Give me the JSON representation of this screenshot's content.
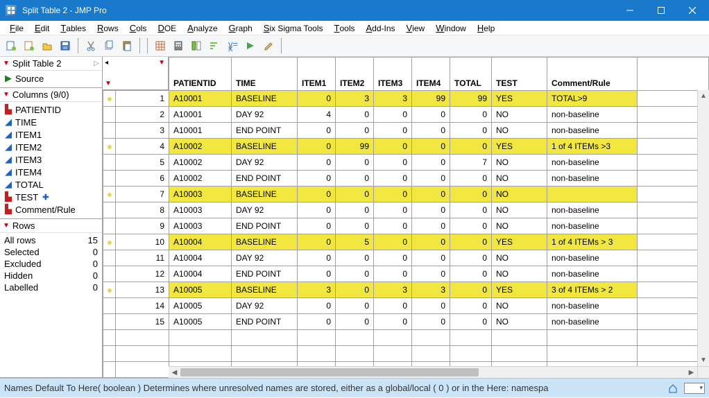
{
  "window": {
    "title": "Split Table 2 - JMP Pro"
  },
  "menu": [
    "File",
    "Edit",
    "Tables",
    "Rows",
    "Cols",
    "DOE",
    "Analyze",
    "Graph",
    "Six Sigma Tools",
    "Tools",
    "Add-Ins",
    "View",
    "Window",
    "Help"
  ],
  "left": {
    "table_name": "Split Table 2",
    "source": "Source",
    "columns_header": "Columns (9/0)",
    "columns": [
      {
        "name": "PATIENTID",
        "type": "red"
      },
      {
        "name": "TIME",
        "type": "blue"
      },
      {
        "name": "ITEM1",
        "type": "blue"
      },
      {
        "name": "ITEM2",
        "type": "blue"
      },
      {
        "name": "ITEM3",
        "type": "blue"
      },
      {
        "name": "ITEM4",
        "type": "blue"
      },
      {
        "name": "TOTAL",
        "type": "blue"
      },
      {
        "name": "TEST",
        "type": "red",
        "plus": true
      },
      {
        "name": "Comment/Rule",
        "type": "red"
      }
    ],
    "rows_header": "Rows",
    "row_stats": [
      {
        "label": "All rows",
        "value": "15"
      },
      {
        "label": "Selected",
        "value": "0"
      },
      {
        "label": "Excluded",
        "value": "0"
      },
      {
        "label": "Hidden",
        "value": "0"
      },
      {
        "label": "Labelled",
        "value": "0"
      }
    ]
  },
  "grid": {
    "headers": [
      "PATIENTID",
      "TIME",
      "ITEM1",
      "ITEM2",
      "ITEM3",
      "ITEM4",
      "TOTAL",
      "TEST",
      "Comment/Rule"
    ],
    "rows": [
      {
        "n": 1,
        "hl": true,
        "dot": true,
        "c": [
          "A10001",
          "BASELINE",
          "0",
          "3",
          "3",
          "99",
          "99",
          "YES",
          "TOTAL>9"
        ]
      },
      {
        "n": 2,
        "hl": false,
        "dot": false,
        "c": [
          "A10001",
          "DAY 92",
          "4",
          "0",
          "0",
          "0",
          "0",
          "NO",
          "non-baseline"
        ]
      },
      {
        "n": 3,
        "hl": false,
        "dot": false,
        "c": [
          "A10001",
          "END POINT",
          "0",
          "0",
          "0",
          "0",
          "0",
          "NO",
          "non-baseline"
        ]
      },
      {
        "n": 4,
        "hl": true,
        "dot": true,
        "c": [
          "A10002",
          "BASELINE",
          "0",
          "99",
          "0",
          "0",
          "0",
          "YES",
          "1 of 4 ITEMs >3"
        ]
      },
      {
        "n": 5,
        "hl": false,
        "dot": false,
        "c": [
          "A10002",
          "DAY 92",
          "0",
          "0",
          "0",
          "0",
          "7",
          "NO",
          "non-baseline"
        ]
      },
      {
        "n": 6,
        "hl": false,
        "dot": false,
        "c": [
          "A10002",
          "END POINT",
          "0",
          "0",
          "0",
          "0",
          "0",
          "NO",
          "non-baseline"
        ]
      },
      {
        "n": 7,
        "hl": true,
        "dot": true,
        "c": [
          "A10003",
          "BASELINE",
          "0",
          "0",
          "0",
          "0",
          "0",
          "NO",
          ""
        ]
      },
      {
        "n": 8,
        "hl": false,
        "dot": false,
        "c": [
          "A10003",
          "DAY 92",
          "0",
          "0",
          "0",
          "0",
          "0",
          "NO",
          "non-baseline"
        ]
      },
      {
        "n": 9,
        "hl": false,
        "dot": false,
        "c": [
          "A10003",
          "END POINT",
          "0",
          "0",
          "0",
          "0",
          "0",
          "NO",
          "non-baseline"
        ]
      },
      {
        "n": 10,
        "hl": true,
        "dot": true,
        "c": [
          "A10004",
          "BASELINE",
          "0",
          "5",
          "0",
          "0",
          "0",
          "YES",
          "1 of 4 ITEMs > 3"
        ]
      },
      {
        "n": 11,
        "hl": false,
        "dot": false,
        "c": [
          "A10004",
          "DAY 92",
          "0",
          "0",
          "0",
          "0",
          "0",
          "NO",
          "non-baseline"
        ]
      },
      {
        "n": 12,
        "hl": false,
        "dot": false,
        "c": [
          "A10004",
          "END POINT",
          "0",
          "0",
          "0",
          "0",
          "0",
          "NO",
          "non-baseline"
        ]
      },
      {
        "n": 13,
        "hl": true,
        "dot": true,
        "c": [
          "A10005",
          "BASELINE",
          "3",
          "0",
          "3",
          "3",
          "0",
          "YES",
          "3 of 4 ITEMs > 2"
        ]
      },
      {
        "n": 14,
        "hl": false,
        "dot": false,
        "c": [
          "A10005",
          "DAY 92",
          "0",
          "0",
          "0",
          "0",
          "0",
          "NO",
          "non-baseline"
        ]
      },
      {
        "n": 15,
        "hl": false,
        "dot": false,
        "c": [
          "A10005",
          "END POINT",
          "0",
          "0",
          "0",
          "0",
          "0",
          "NO",
          "non-baseline"
        ]
      }
    ]
  },
  "status": "Names Default To Here( boolean )   Determines where unresolved names are stored, either as a global/local ( 0 ) or in the Here: namespa"
}
